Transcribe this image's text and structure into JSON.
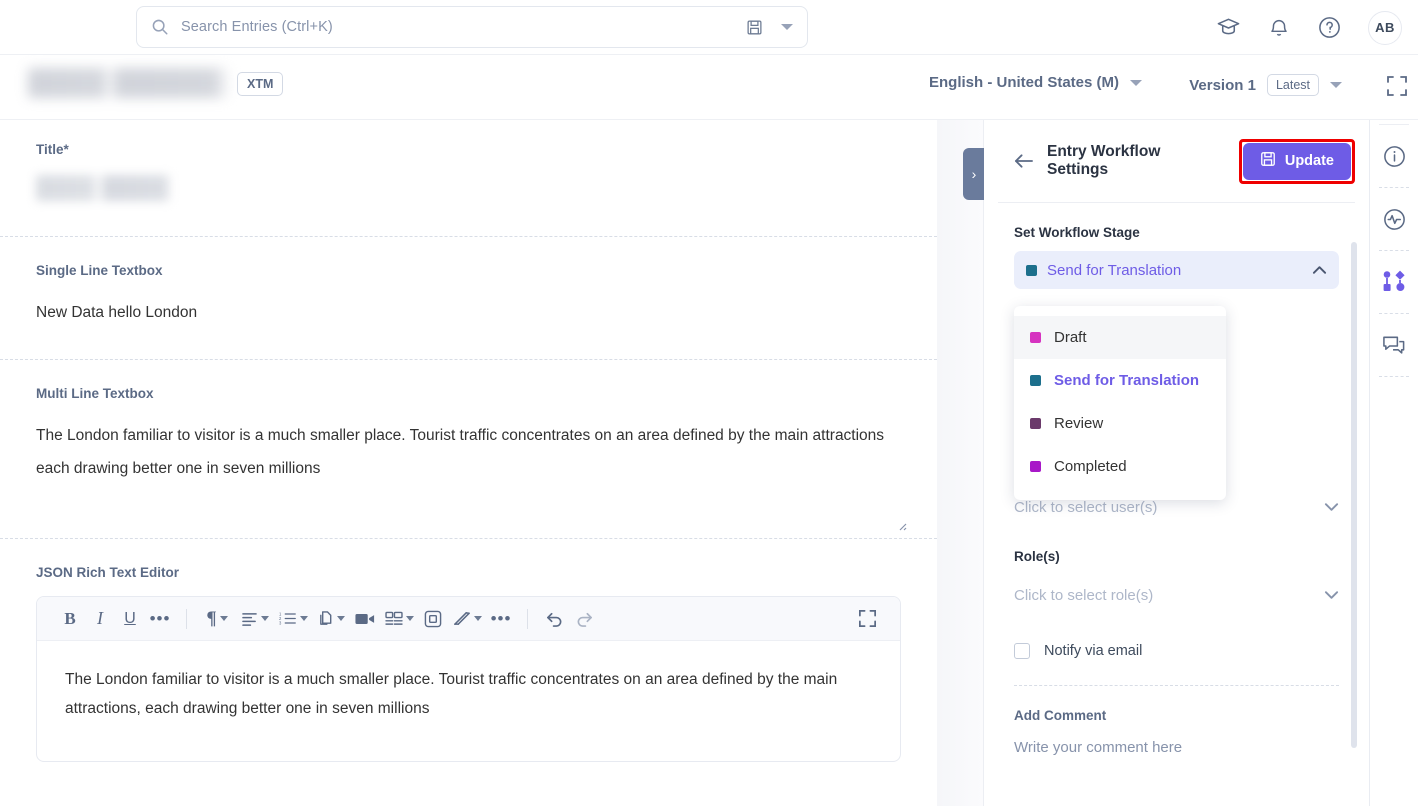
{
  "topbar": {
    "search": {
      "placeholder": "Search Entries (Ctrl+K)",
      "icon": "search-icon",
      "save_icon": "floppy-disk-icon",
      "caret_icon": "caret-down-icon"
    },
    "icons": [
      {
        "name": "graduation-cap-icon"
      },
      {
        "name": "bell-icon"
      },
      {
        "name": "help-circle-icon"
      }
    ],
    "avatar_initials": "AB"
  },
  "subbar": {
    "entry_title": "",
    "xtm_badge": "XTM",
    "language": "English - United States (M)",
    "version": "Version 1",
    "version_chip": "Latest",
    "expand_icon": "fullscreen-icon"
  },
  "content": {
    "fields": [
      {
        "label": "Title*",
        "value": "",
        "blurred": true
      },
      {
        "label": "Single Line Textbox",
        "value": "New Data hello London"
      },
      {
        "label": "Multi Line Textbox",
        "value": "The London familiar to visitor is a much smaller place. Tourist traffic concentrates on an area defined by the main attractions each drawing better one in seven millions"
      }
    ],
    "rte": {
      "label": "JSON Rich Text Editor",
      "body": "The London familiar to visitor is a much smaller place. Tourist traffic concentrates on an area defined by the main attractions, each drawing better one in seven millions",
      "toolbar": [
        {
          "name": "bold-button",
          "glyph": "B",
          "kind": "text"
        },
        {
          "name": "italic-button",
          "glyph": "I",
          "kind": "italic"
        },
        {
          "name": "underline-button",
          "glyph": "U",
          "kind": "underline"
        },
        {
          "name": "more-text-options-button",
          "glyph": "•••",
          "kind": "dots"
        },
        {
          "name": "toolbar-separator",
          "kind": "sep"
        },
        {
          "name": "paragraph-format-dropdown",
          "glyph": "¶",
          "kind": "dropdown"
        },
        {
          "name": "text-align-dropdown",
          "glyph": "align",
          "kind": "dropdown-icon"
        },
        {
          "name": "list-dropdown",
          "glyph": "list",
          "kind": "dropdown-icon"
        },
        {
          "name": "copy-dropdown",
          "glyph": "copy",
          "kind": "dropdown-icon"
        },
        {
          "name": "insert-video-button",
          "glyph": "video",
          "kind": "icon"
        },
        {
          "name": "insert-table-dropdown",
          "glyph": "table",
          "kind": "dropdown-icon"
        },
        {
          "name": "insert-image-button",
          "glyph": "frame",
          "kind": "icon"
        },
        {
          "name": "highlight-dropdown",
          "glyph": "highlight",
          "kind": "dropdown-icon"
        },
        {
          "name": "more-options-button",
          "glyph": "•••",
          "kind": "dots"
        },
        {
          "name": "toolbar-separator-2",
          "kind": "sep"
        },
        {
          "name": "undo-button",
          "glyph": "undo",
          "kind": "icon"
        },
        {
          "name": "redo-button",
          "glyph": "redo",
          "kind": "icon"
        },
        {
          "name": "editor-fullscreen-button",
          "glyph": "fullscreen",
          "kind": "icon"
        }
      ]
    }
  },
  "panel": {
    "collapse_chevron": "›",
    "back_icon": "arrow-left-icon",
    "title": "Entry Workflow Settings",
    "update_label": "Update",
    "update_icon": "floppy-disk-icon",
    "update_color": "#6e5ce6",
    "highlight_color": "#ef0000",
    "stage_label": "Set Workflow Stage",
    "stage_selected": "Send for Translation",
    "stage_selected_color": "#1c6f8c",
    "stage_options": [
      {
        "label": "Draft",
        "color": "#d633c0"
      },
      {
        "label": "Send for Translation",
        "color": "#1c6f8c"
      },
      {
        "label": "Review",
        "color": "#6b3a6b"
      },
      {
        "label": "Completed",
        "color": "#a818c8"
      }
    ],
    "users_placeholder": "Click to select user(s)",
    "roles_label": "Role(s)",
    "roles_placeholder": "Click to select role(s)",
    "notify_label": "Notify via email",
    "comment_label": "Add Comment",
    "comment_placeholder": "Write your comment here"
  },
  "rail": {
    "items": [
      {
        "name": "fullscreen-icon"
      },
      {
        "name": "info-circle-icon"
      },
      {
        "name": "activity-pulse-icon"
      },
      {
        "name": "workflow-icon",
        "active": true,
        "color": "#6e5ce6"
      },
      {
        "name": "comments-icon"
      }
    ]
  }
}
